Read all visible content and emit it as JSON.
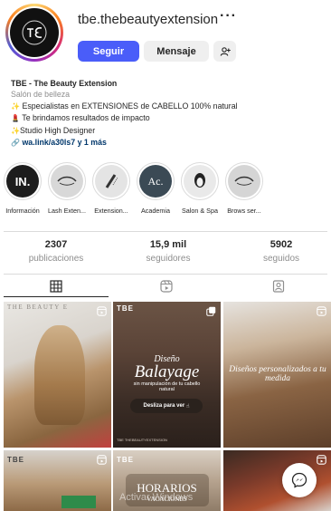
{
  "profile": {
    "username": "tbe.thebeautyextension",
    "avatar_icon": "tbe-logo",
    "more_icon": "more-horizontal-icon",
    "follow_label": "Seguir",
    "message_label": "Mensaje",
    "add_person_icon": "add-person-icon"
  },
  "bio": {
    "name": "TBE - The Beauty Extension",
    "category": "Salón de belleza",
    "lines": [
      {
        "icon": "sparkles",
        "text": "Especialistas en EXTENSIONES de CABELLO 100% natural"
      },
      {
        "icon": "lipstick",
        "text": "Te brindamos resultados de impacto"
      },
      {
        "icon": "sparkles",
        "text": "Studio High Designer"
      }
    ],
    "link_icon": "link-icon",
    "link": "wa.link/a30ls7 y 1 más"
  },
  "highlights": [
    {
      "label": "Información",
      "icon": "in-logo"
    },
    {
      "label": "Lash Exten...",
      "icon": "eye-icon"
    },
    {
      "label": "Extension...",
      "icon": "comb-icon"
    },
    {
      "label": "Academia",
      "icon": "ac-logo"
    },
    {
      "label": "Salon & Spa",
      "icon": "face-icon"
    },
    {
      "label": "Brows ser...",
      "icon": "eye-icon"
    }
  ],
  "stats": {
    "posts_count": "2307",
    "posts_label": "publicaciones",
    "followers_count": "15,9 mil",
    "followers_label": "seguidores",
    "following_count": "5902",
    "following_label": "seguidos"
  },
  "tabs": [
    {
      "name": "grid",
      "icon": "grid-icon",
      "active": true
    },
    {
      "name": "reels",
      "icon": "reels-icon",
      "active": false
    },
    {
      "name": "tagged",
      "icon": "tagged-icon",
      "active": false
    }
  ],
  "posts": [
    {
      "type": "reel",
      "text_top": "THE BEAUTY E",
      "text": ""
    },
    {
      "type": "carousel",
      "brand": "TBE",
      "title_small": "Diseño",
      "title_big": "Balayage",
      "subtitle": "sin manipulación de tu cabello natural",
      "cta": "Desliza para ver",
      "footer": "TBE THEBEAUTYEXTENSION"
    },
    {
      "type": "reel",
      "text": "Diseños personalizados a tu medida"
    },
    {
      "type": "reel",
      "brand": "TBE",
      "text": ""
    },
    {
      "type": "photo",
      "brand": "TBE",
      "title_big": "HORARIOS",
      "subtitle": "VACACIONES"
    },
    {
      "type": "reel",
      "text": ""
    }
  ],
  "messenger_icon": "messenger-icon",
  "watermark": "Activar Windows"
}
